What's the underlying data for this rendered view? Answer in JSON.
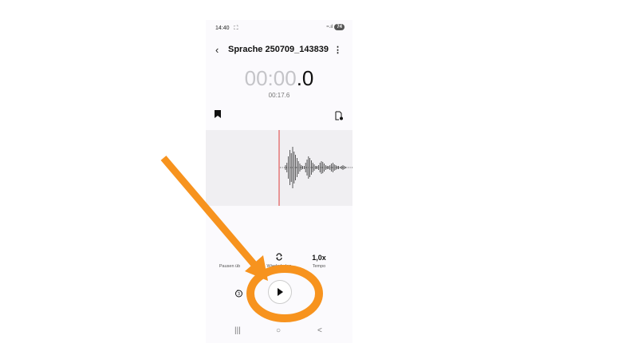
{
  "status_bar": {
    "time": "14:40",
    "cast_icon": "cast-icon",
    "signal": "≈.ıl",
    "battery": "74"
  },
  "header": {
    "back_icon": "back-arrow-icon",
    "title": "Sprache 250709_143839",
    "more_icon": "more-icon"
  },
  "player": {
    "time_main": "00:00",
    "time_tenth": ".0",
    "duration": "00:17.6"
  },
  "toolbar": {
    "bookmark_icon": "bookmark-icon",
    "note_icon": "note-icon"
  },
  "controls": [
    {
      "id": "skip-pauses",
      "icon": "",
      "label": "Pausen üb"
    },
    {
      "id": "repeat",
      "icon": "repeat-icon",
      "label": "Wiederholen"
    },
    {
      "id": "tempo",
      "icon": "1,0x",
      "label": "Tempo"
    }
  ],
  "play_button": {
    "icon": "play-icon"
  },
  "rewind": {
    "icon": "rewind-icon"
  },
  "nav_bar": {
    "recents": "|||",
    "home": "○",
    "back": "<"
  },
  "colors": {
    "accent": "#f7931e",
    "playhead": "#e03b3b"
  }
}
